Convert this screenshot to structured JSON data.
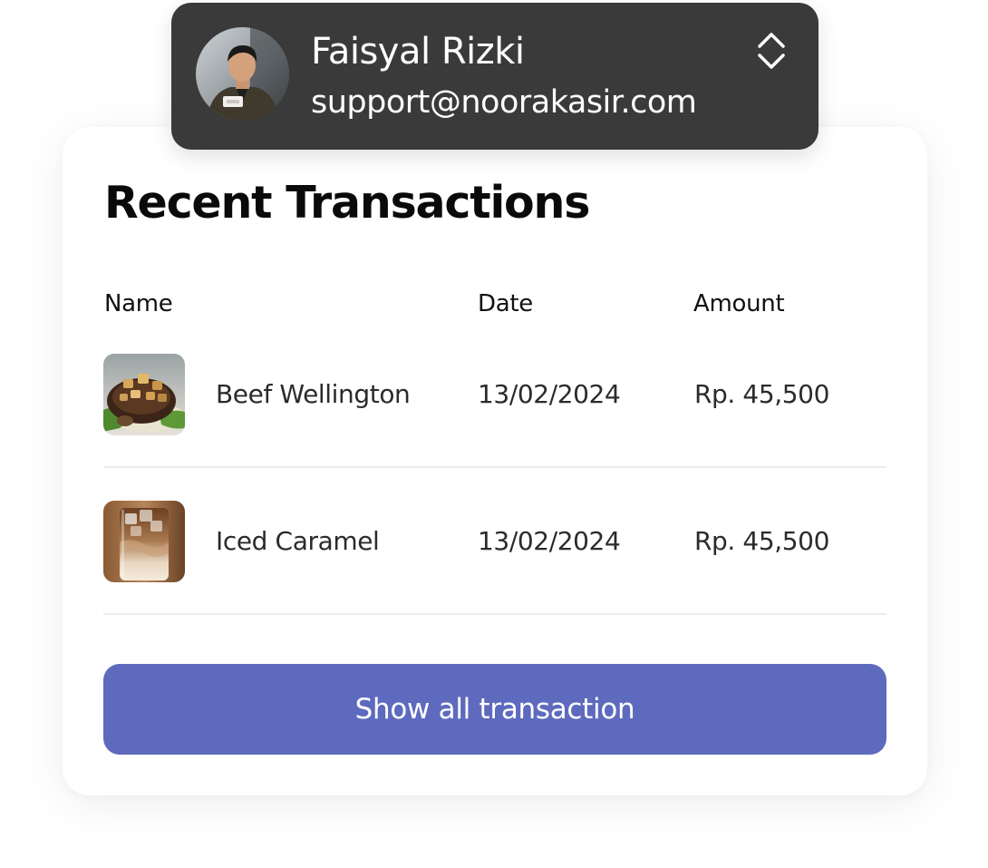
{
  "account": {
    "name": "Faisyal Rizki",
    "email": "support@noorakasir.com",
    "avatar_icon": "user-avatar-photo",
    "switch_icon": "chevron-up-down-icon"
  },
  "transactions": {
    "title": "Recent Transactions",
    "columns": [
      "Name",
      "Date",
      "Amount"
    ],
    "rows": [
      {
        "name": "Beef Wellington",
        "date": "13/02/2024",
        "amount": "Rp. 45,500",
        "thumbnail": "beef-wellington-photo"
      },
      {
        "name": "Iced Caramel",
        "date": "13/02/2024",
        "amount": "Rp. 45,500",
        "thumbnail": "iced-caramel-photo"
      }
    ],
    "show_all_label": "Show all transaction"
  },
  "colors": {
    "accent": "#5e6abe",
    "account_bg": "#3a3a3a",
    "card_bg": "#ffffff",
    "divider": "#ececec"
  }
}
